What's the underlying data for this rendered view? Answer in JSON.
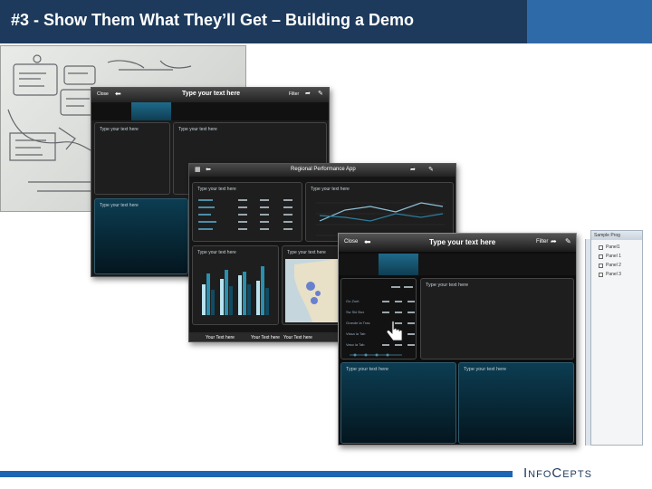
{
  "slide": {
    "title": "#3 - Show Them What They’ll Get – Building a Demo",
    "logo_text": "InfoCepts",
    "colors": {
      "title_bg": "#1d3a5c",
      "accent": "#2f6aa8",
      "rule": "#1e66b4"
    }
  },
  "app1": {
    "close_label": "Close",
    "title": "Type your text here",
    "filter_label": "Filter",
    "panels": [
      "Type your text here",
      "Type your text here",
      "Type your text here"
    ]
  },
  "app2": {
    "title": "Regional Performance App",
    "panel1_title": "Type your text here",
    "panel2_title": "Type your text here",
    "panel3_title": "Type your text here",
    "panel4_title": "Type your text here",
    "footer_labels": [
      "Your Text here",
      "Your Text here",
      "Your Text here"
    ]
  },
  "app3": {
    "close_label": "Close",
    "title": "Type your text here",
    "filter_label": "Filter",
    "panels": [
      "Type your text here",
      "Type your text here",
      "Type your text here"
    ],
    "table_rows": [
      "Go Zoet",
      "Sw Ski Box",
      "Grande la Tras",
      "Vissa la Tab",
      "Vaso la Tab"
    ]
  },
  "side_panel": {
    "header": "Sample Prog",
    "items": [
      "Panel1",
      "Panel 1",
      "Panel 2",
      "Panel 3"
    ]
  }
}
